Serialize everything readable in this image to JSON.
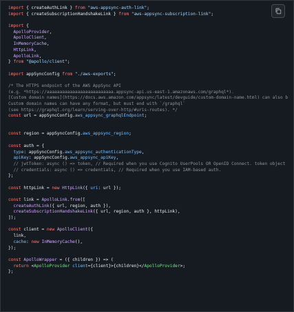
{
  "copy_button": {
    "icon": "copy-icon"
  },
  "colors": {
    "background": "#161b22",
    "keyword": "#ff7b72",
    "string": "#a5d6ff",
    "function": "#d2a8ff",
    "comment": "#8b949e",
    "property": "#79c0ff",
    "tag": "#7ee787",
    "text": "#e6edf3"
  },
  "code_lines": [
    [
      [
        "k",
        "import"
      ],
      [
        "x",
        " { createAuthLink } "
      ],
      [
        "k",
        "from"
      ],
      [
        "x",
        " "
      ],
      [
        "s",
        "\"aws-appsync-auth-link\""
      ],
      [
        "x",
        ";"
      ]
    ],
    [
      [
        "k",
        "import"
      ],
      [
        "x",
        " { createSubscriptionHandshakeLink } "
      ],
      [
        "k",
        "from"
      ],
      [
        "x",
        " "
      ],
      [
        "s",
        "\"aws-appsync-subscription-link\""
      ],
      [
        "x",
        ";"
      ]
    ],
    [],
    [
      [
        "k",
        "import"
      ],
      [
        "x",
        " {"
      ]
    ],
    [
      [
        "x",
        "  "
      ],
      [
        "f",
        "ApolloProvider"
      ],
      [
        "x",
        ","
      ]
    ],
    [
      [
        "x",
        "  "
      ],
      [
        "f",
        "ApolloClient"
      ],
      [
        "x",
        ","
      ]
    ],
    [
      [
        "x",
        "  "
      ],
      [
        "f",
        "InMemoryCache"
      ],
      [
        "x",
        ","
      ]
    ],
    [
      [
        "x",
        "  "
      ],
      [
        "f",
        "HttpLink"
      ],
      [
        "x",
        ","
      ]
    ],
    [
      [
        "x",
        "  "
      ],
      [
        "f",
        "ApolloLink"
      ],
      [
        "x",
        ","
      ]
    ],
    [
      [
        "x",
        "} "
      ],
      [
        "k",
        "from"
      ],
      [
        "x",
        " "
      ],
      [
        "s",
        "\"@apollo/client\""
      ],
      [
        "x",
        ";"
      ]
    ],
    [],
    [
      [
        "k",
        "import"
      ],
      [
        "x",
        " appSyncConfig "
      ],
      [
        "k",
        "from"
      ],
      [
        "x",
        " "
      ],
      [
        "s",
        "\"./aws-exports\""
      ],
      [
        "x",
        ";"
      ]
    ],
    [],
    [
      [
        "c",
        "/* The HTTPS endpoint of the AWS AppSync API"
      ]
    ],
    [
      [
        "c",
        "(e.g. *https://aaaaaaaaaaaaaaaaaaaaaaaaaa.appsync-api.us-east-1.amazonaws.com/graphql*)."
      ]
    ],
    [
      [
        "c",
        "[Custom domain names](https://docs.aws.amazon.com/appsync/latest/devguide/custom-domain-name.html) can also b"
      ]
    ],
    [
      [
        "c",
        "Custom domain names can have any format, but must end with `/graphql`"
      ]
    ],
    [
      [
        "c",
        "(see https://graphql.org/learn/serving-over-http/#uris-routes). */"
      ]
    ],
    [
      [
        "k",
        "const"
      ],
      [
        "x",
        " url = appSyncConfig."
      ],
      [
        "p",
        "aws_appsync_graphqlEndpoint"
      ],
      [
        "x",
        ";"
      ]
    ],
    [],
    [],
    [
      [
        "k",
        "const"
      ],
      [
        "x",
        " region = appSyncConfig."
      ],
      [
        "p",
        "aws_appsync_region"
      ],
      [
        "x",
        ";"
      ]
    ],
    [],
    [
      [
        "k",
        "const"
      ],
      [
        "x",
        " auth = {"
      ]
    ],
    [
      [
        "x",
        "  "
      ],
      [
        "p",
        "type"
      ],
      [
        "x",
        ": appSyncConfig."
      ],
      [
        "p",
        "aws_appsync_authenticationType"
      ],
      [
        "x",
        ","
      ]
    ],
    [
      [
        "x",
        "  "
      ],
      [
        "p",
        "apiKey"
      ],
      [
        "x",
        ": appSyncConfig."
      ],
      [
        "p",
        "aws_appsync_apiKey"
      ],
      [
        "x",
        ","
      ]
    ],
    [
      [
        "x",
        "  "
      ],
      [
        "c",
        "// jwtToken: async () => token, // Required when you use Cognito UserPools OR OpenID Connect. token object"
      ]
    ],
    [
      [
        "x",
        "  "
      ],
      [
        "c",
        "// credentials: async () => credentials, // Required when you use IAM-based auth."
      ]
    ],
    [
      [
        "x",
        "};"
      ]
    ],
    [],
    [
      [
        "k",
        "const"
      ],
      [
        "x",
        " httpLink = "
      ],
      [
        "k",
        "new"
      ],
      [
        "x",
        " "
      ],
      [
        "f",
        "HttpLink"
      ],
      [
        "x",
        "({ "
      ],
      [
        "p",
        "uri"
      ],
      [
        "x",
        ": url });"
      ]
    ],
    [],
    [
      [
        "k",
        "const"
      ],
      [
        "x",
        " link = "
      ],
      [
        "f",
        "ApolloLink"
      ],
      [
        "x",
        "."
      ],
      [
        "f",
        "from"
      ],
      [
        "x",
        "(["
      ]
    ],
    [
      [
        "x",
        "  "
      ],
      [
        "f",
        "createAuthLink"
      ],
      [
        "x",
        "({ url, region, auth }),"
      ]
    ],
    [
      [
        "x",
        "  "
      ],
      [
        "f",
        "createSubscriptionHandshakeLink"
      ],
      [
        "x",
        "({ url, region, auth }, httpLink),"
      ]
    ],
    [
      [
        "x",
        "]);"
      ]
    ],
    [],
    [
      [
        "k",
        "const"
      ],
      [
        "x",
        " client = "
      ],
      [
        "k",
        "new"
      ],
      [
        "x",
        " "
      ],
      [
        "f",
        "ApolloClient"
      ],
      [
        "x",
        "({"
      ]
    ],
    [
      [
        "x",
        "  link,"
      ]
    ],
    [
      [
        "x",
        "  "
      ],
      [
        "p",
        "cache"
      ],
      [
        "x",
        ": "
      ],
      [
        "k",
        "new"
      ],
      [
        "x",
        " "
      ],
      [
        "f",
        "InMemoryCache"
      ],
      [
        "x",
        "(),"
      ]
    ],
    [
      [
        "x",
        "});"
      ]
    ],
    [],
    [
      [
        "k",
        "const"
      ],
      [
        "x",
        " "
      ],
      [
        "f",
        "ApolloWrapper"
      ],
      [
        "x",
        " = ({ children }) => ("
      ]
    ],
    [
      [
        "x",
        "  "
      ],
      [
        "k",
        "return"
      ],
      [
        "x",
        " <"
      ],
      [
        "t",
        "ApolloProvider"
      ],
      [
        "x",
        " "
      ],
      [
        "p",
        "client"
      ],
      [
        "x",
        "={client}>{children}</"
      ],
      [
        "t",
        "ApolloProvider"
      ],
      [
        "x",
        ">;"
      ]
    ],
    [
      [
        "x",
        "};"
      ]
    ]
  ]
}
